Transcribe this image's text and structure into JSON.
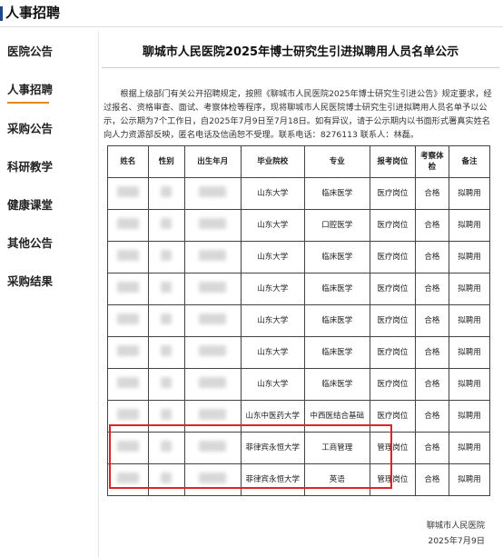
{
  "header": {
    "title": "人事招聘"
  },
  "sidebar": {
    "items": [
      {
        "label": "医院公告"
      },
      {
        "label": "人事招聘",
        "active": true
      },
      {
        "label": "采购公告"
      },
      {
        "label": "科研教学"
      },
      {
        "label": "健康课堂"
      },
      {
        "label": "其他公告"
      },
      {
        "label": "采购结果"
      }
    ]
  },
  "article": {
    "title": "聊城市人民医院2025年博士研究生引进拟聘用人员名单公示",
    "intro": "根据上级部门有关公开招聘规定，按照《聊城市人民医院2025年博士研究生引进公告》规定要求，经过报名、资格审查、面试、考察体检等程序，现将聊城市人民医院博士研究生引进拟聘用人员名单予以公示，公示期为7个工作日，自2025年7月9日至7月18日。如有异议，请于公示期内以书面形式署真实姓名向人力资源部反映，匿名电话及信函恕不受理。联系电话：8276113  联系人：林磊。",
    "table": {
      "headers": [
        "姓名",
        "性别",
        "出生年月",
        "毕业院校",
        "专业",
        "报考岗位",
        "考察体检",
        "备注"
      ],
      "rows": [
        {
          "school": "山东大学",
          "major": "临床医学",
          "post": "医疗岗位",
          "check": "合格",
          "note": "拟聘用"
        },
        {
          "school": "山东大学",
          "major": "口腔医学",
          "post": "医疗岗位",
          "check": "合格",
          "note": "拟聘用"
        },
        {
          "school": "山东大学",
          "major": "临床医学",
          "post": "医疗岗位",
          "check": "合格",
          "note": "拟聘用"
        },
        {
          "school": "山东大学",
          "major": "临床医学",
          "post": "医疗岗位",
          "check": "合格",
          "note": "拟聘用"
        },
        {
          "school": "山东大学",
          "major": "临床医学",
          "post": "医疗岗位",
          "check": "合格",
          "note": "拟聘用"
        },
        {
          "school": "山东大学",
          "major": "临床医学",
          "post": "医疗岗位",
          "check": "合格",
          "note": "拟聘用"
        },
        {
          "school": "山东大学",
          "major": "临床医学",
          "post": "医疗岗位",
          "check": "合格",
          "note": "拟聘用"
        },
        {
          "school": "山东中医药大学",
          "major": "中西医结合基础",
          "post": "医疗岗位",
          "check": "合格",
          "note": "拟聘用"
        },
        {
          "school": "菲律宾永恒大学",
          "major": "工商管理",
          "post": "管理岗位",
          "check": "合格",
          "note": "拟聘用"
        },
        {
          "school": "菲律宾永恒大学",
          "major": "英语",
          "post": "管理岗位",
          "check": "合格",
          "note": "拟聘用"
        }
      ]
    },
    "signature": {
      "org": "聊城市人民医院",
      "date": "2025年7月9日"
    }
  },
  "colors": {
    "accent": "#1a4a8a",
    "active_underline": "#e08a1e",
    "highlight": "#e02424"
  }
}
